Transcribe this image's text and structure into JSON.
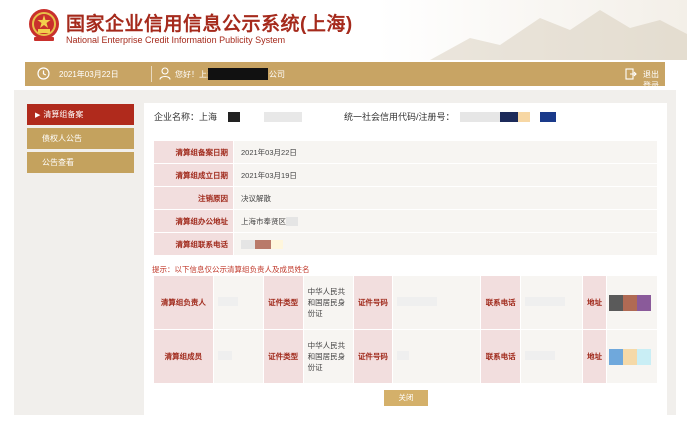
{
  "header": {
    "title_cn": "国家企业信用信息公示系统(上海)",
    "title_en": "National Enterprise Credit Information Publicity System"
  },
  "topbar": {
    "date": "2021年03月22日",
    "greeting_prefix": "您好！上海",
    "greeting_suffix": "公司",
    "logout_label": "退出登录"
  },
  "sidebar": {
    "items": [
      {
        "label": "清算组备案",
        "active": true
      },
      {
        "label": "债权人公告",
        "active": false
      },
      {
        "label": "公告查看",
        "active": false
      }
    ]
  },
  "company": {
    "name_label": "企业名称：",
    "name_value": "上海",
    "code_label": "统一社会信用代码/注册号："
  },
  "filing": {
    "rows": [
      {
        "label": "清算组备案日期",
        "value": "2021年03月22日"
      },
      {
        "label": "清算组成立日期",
        "value": "2021年03月19日"
      },
      {
        "label": "注销原因",
        "value": "决议解散"
      },
      {
        "label": "清算组办公地址",
        "value": "上海市奉贤区"
      },
      {
        "label": "清算组联系电话",
        "value": ""
      }
    ]
  },
  "hint": "提示：以下信息仅公示清算组负责人及成员姓名",
  "members": {
    "rows": [
      {
        "role_label": "清算组负责人",
        "doc_type_label": "证件类型",
        "doc_type_value": "中华人民共和国居民身份证",
        "doc_no_label": "证件号码",
        "phone_label": "联系电话",
        "address_label": "地址"
      },
      {
        "role_label": "清算组成员",
        "doc_type_label": "证件类型",
        "doc_type_value": "中华人民共和国居民身份证",
        "doc_no_label": "证件号码",
        "phone_label": "联系电话",
        "address_label": "地址"
      }
    ]
  },
  "close_label": "关闭"
}
